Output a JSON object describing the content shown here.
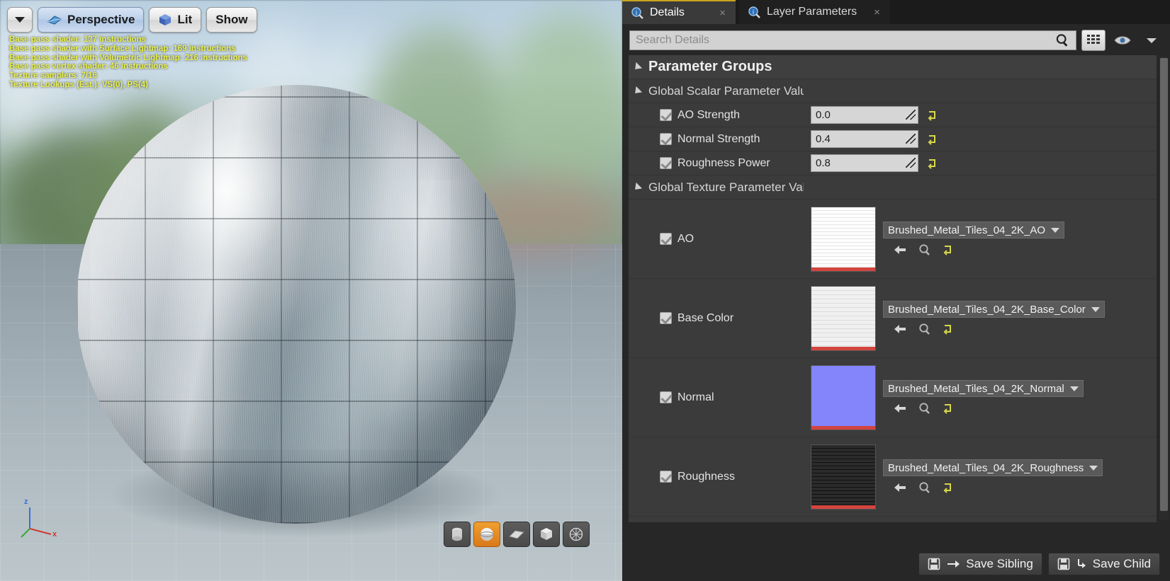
{
  "viewport": {
    "toolbar": {
      "dropdown_icon": "chevron-down-icon",
      "perspective_label": "Perspective",
      "lit_label": "Lit",
      "show_label": "Show"
    },
    "stats": [
      "Base pass shader: 137 instructions",
      "Base pass shader with Surface Lightmap: 169 instructions",
      "Base pass shader with Volumetric Lightmap: 216 instructions",
      "Base pass vertex shader: 46 instructions",
      "Texture samplers: 7/16",
      "Texture Lookups (Est.): VS(0), PS(4)"
    ],
    "axis": {
      "z_label": "z",
      "x_label": "x"
    },
    "preview_tools": [
      {
        "name": "cylinder-preview-button",
        "active": false
      },
      {
        "name": "sphere-preview-button",
        "active": true
      },
      {
        "name": "plane-preview-button",
        "active": false
      },
      {
        "name": "cube-preview-button",
        "active": false
      },
      {
        "name": "custom-mesh-preview-button",
        "active": false
      }
    ]
  },
  "panel": {
    "tabs": [
      {
        "label": "Details",
        "icon": "details-magnifier-icon",
        "active": true,
        "closable": true
      },
      {
        "label": "Layer Parameters",
        "icon": "details-magnifier-icon",
        "active": false,
        "closable": true
      }
    ],
    "search": {
      "placeholder": "Search Details",
      "value": "",
      "icon": "search-icon"
    },
    "toolbar_icons": [
      {
        "name": "grid-view-button",
        "icon": "grid-icon"
      },
      {
        "name": "visibility-button",
        "icon": "eye-icon"
      },
      {
        "name": "view-options-dropdown",
        "icon": "chevron-down-icon"
      }
    ],
    "groups": {
      "root_title": "Parameter Groups",
      "scalar_group_title": "Global Scalar Parameter Values",
      "texture_group_title": "Global Texture Parameter Value",
      "scalars": [
        {
          "label": "AO Strength",
          "value": "0.0",
          "checked": true
        },
        {
          "label": "Normal Strength",
          "value": "0.4",
          "checked": true
        },
        {
          "label": "Roughness Power",
          "value": "0.8",
          "checked": true
        }
      ],
      "textures": [
        {
          "label": "AO",
          "asset": "Brushed_Metal_Tiles_04_2K_AO",
          "checked": true,
          "thumb": "white"
        },
        {
          "label": "Base Color",
          "asset": "Brushed_Metal_Tiles_04_2K_Base_Color",
          "checked": true,
          "thumb": "basecolor"
        },
        {
          "label": "Normal",
          "asset": "Brushed_Metal_Tiles_04_2K_Normal",
          "checked": true,
          "thumb": "normal"
        },
        {
          "label": "Roughness",
          "asset": "Brushed_Metal_Tiles_04_2K_Roughness",
          "checked": true,
          "thumb": "rough"
        }
      ]
    },
    "footer": {
      "save_sibling_label": "Save Sibling",
      "save_child_label": "Save Child"
    }
  },
  "colors": {
    "accent_yellow": "#c8a51e",
    "reset_icon": "#d8d84a",
    "active_tool": "#e8901f",
    "stats_text": "#e8ef4a",
    "thumb_red_bar": "#d2453f"
  }
}
